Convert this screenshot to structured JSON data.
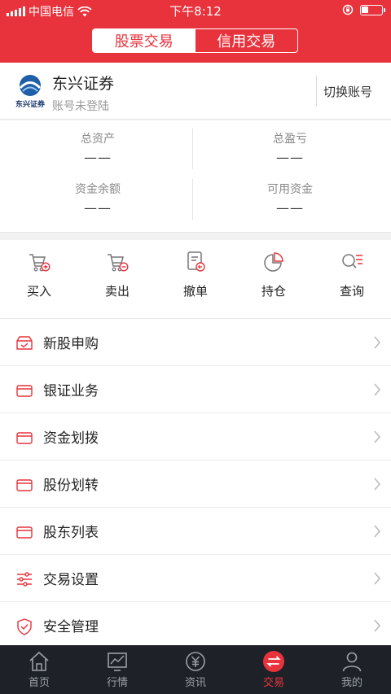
{
  "status_bar": {
    "carrier": "中国电信",
    "time": "下午8:12"
  },
  "header": {
    "tabs": [
      {
        "label": "股票交易",
        "active": true
      },
      {
        "label": "信用交易",
        "active": false
      }
    ]
  },
  "account": {
    "broker_name": "东兴证券",
    "logo_text": "东兴证券",
    "login_status": "账号未登陆",
    "switch_label": "切换账号"
  },
  "assets": {
    "total_assets_label": "总资产",
    "total_assets_value": "——",
    "total_pnl_label": "总盈亏",
    "total_pnl_value": "——",
    "balance_label": "资金余额",
    "balance_value": "——",
    "available_label": "可用资金",
    "available_value": "——"
  },
  "actions": [
    {
      "label": "买入",
      "icon": "cart-plus-icon"
    },
    {
      "label": "卖出",
      "icon": "cart-minus-icon"
    },
    {
      "label": "撤单",
      "icon": "cancel-order-icon"
    },
    {
      "label": "持仓",
      "icon": "pie-chart-icon"
    },
    {
      "label": "查询",
      "icon": "search-list-icon"
    }
  ],
  "menu": [
    {
      "label": "新股申购",
      "icon": "ipo-box-icon"
    },
    {
      "label": "银证业务",
      "icon": "card-icon"
    },
    {
      "label": "资金划拨",
      "icon": "card-icon"
    },
    {
      "label": "股份划转",
      "icon": "card-icon"
    },
    {
      "label": "股东列表",
      "icon": "card-icon"
    },
    {
      "label": "交易设置",
      "icon": "sliders-icon"
    },
    {
      "label": "安全管理",
      "icon": "shield-icon"
    }
  ],
  "tabbar": [
    {
      "label": "首页",
      "icon": "home-icon",
      "active": false
    },
    {
      "label": "行情",
      "icon": "chart-icon",
      "active": false
    },
    {
      "label": "资讯",
      "icon": "yuan-icon",
      "active": false
    },
    {
      "label": "交易",
      "icon": "trade-icon",
      "active": true
    },
    {
      "label": "我的",
      "icon": "user-icon",
      "active": false
    }
  ],
  "colors": {
    "brand": "#e8323c",
    "tabbar_bg": "#1e2228",
    "tab_inactive": "#9aa0a8"
  }
}
